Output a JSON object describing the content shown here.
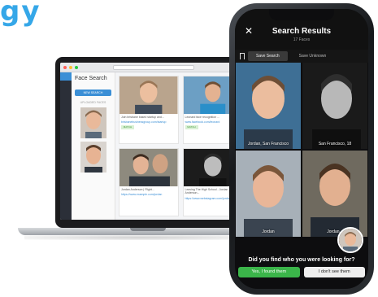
{
  "brand": {
    "fragment": "gy",
    "accent": "#35a7e8"
  },
  "laptop": {
    "app": {
      "panel_title": "Face Search",
      "new_search_label": "NEW SEARCH",
      "upload_label": "UPLOADED FACES",
      "results": [
        {
          "text": "Join brisbane based startup and...",
          "link": "brisbanebusinessgroup.com/startup",
          "tag": "MATCH"
        },
        {
          "text": "Leonard face recognition ...",
          "link": "www.facebook.com/leonard",
          "tag": "MATCH"
        },
        {
          "text": "Jordan Anderson | Flight...",
          "link": "https://www.example.com/jordan",
          "tag": "MATCH"
        },
        {
          "text": "Leaving The High School - Jordan Anderson...",
          "link": "https://www.webstagram.com/jordan",
          "tag": "MATCH"
        }
      ]
    }
  },
  "phone": {
    "title": "Search Results",
    "subtitle": "17 Faces",
    "tabs": [
      "Save Search",
      "Save Unknown"
    ],
    "cells": [
      {
        "caption": "Jordan, San Francisco"
      },
      {
        "caption": "San Francisco, 18"
      },
      {
        "caption": "Jordan"
      },
      {
        "caption": "Jordan..."
      }
    ],
    "question": "Did you find who you were looking for?",
    "yes_label": "Yes, I found them",
    "no_label": "I don't see them",
    "colors": {
      "yes": "#3bb54a",
      "no": "#eeeeee"
    }
  }
}
